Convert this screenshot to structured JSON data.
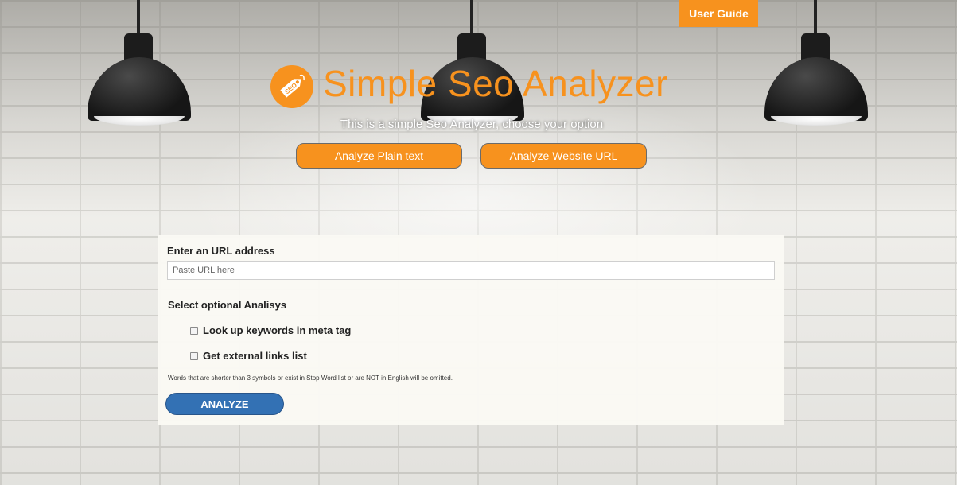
{
  "header": {
    "user_guide_label": "User Guide",
    "title": "Simple Seo Analyzer",
    "subtitle": "This is a simple Seo Analyzer, choose your option",
    "logo_icon": "seo-tag-icon",
    "logo_text": "SEO"
  },
  "options": {
    "plain_text_label": "Analyze Plain text",
    "website_url_label": "Analyze Website URL"
  },
  "form": {
    "url_label": "Enter an URL address",
    "url_value": "",
    "url_placeholder": "Paste URL here",
    "optional_label": "Select optional Analisys",
    "checkboxes": [
      {
        "label": "Look up keywords in meta tag",
        "checked": false
      },
      {
        "label": "Get external links list",
        "checked": false
      }
    ],
    "note": "Words that are shorter than 3 symbols or exist in Stop Word list or are NOT in English will be omitted.",
    "analyze_label": "ANALYZE"
  },
  "colors": {
    "accent": "#f7921e",
    "primary_button": "#3371b4",
    "panel_bg": "#faf9f4"
  }
}
